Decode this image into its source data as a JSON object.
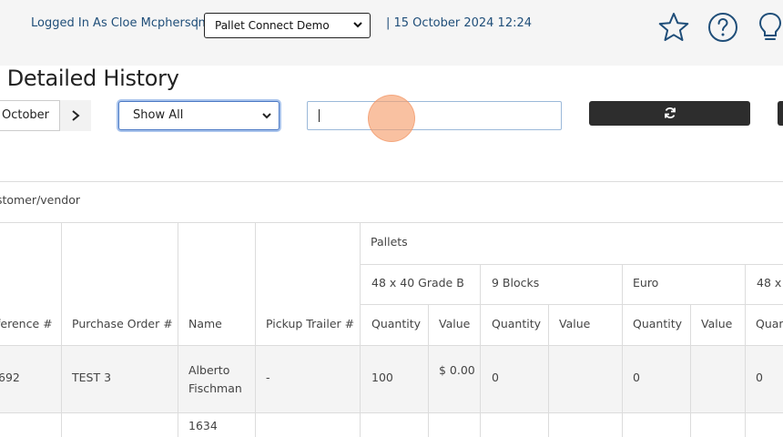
{
  "header": {
    "user_text": "Logged In As Cloe Mcpherson",
    "separator": "|",
    "company_selected": "Pallet Connect Demo",
    "datetime_text": "| 15 October 2024 12:24",
    "icons": [
      "star-icon",
      "help-circle-icon",
      "lightbulb-icon"
    ]
  },
  "page": {
    "title": "l Detailed History"
  },
  "filters": {
    "month": "October",
    "show_filter": "Show All",
    "search_value": ""
  },
  "table": {
    "customer_vendor_label": "stomer/vendor",
    "columns": {
      "reference": "ference #",
      "purchase_order": "Purchase Order #",
      "name": "Name",
      "pickup_trailer": "Pickup Trailer #",
      "pallets": "Pallets"
    },
    "pallet_types": [
      "48 x 40 Grade B",
      "9 Blocks",
      "Euro",
      "48 x"
    ],
    "sub_columns": {
      "quantity": "Quantity",
      "value": "Value",
      "quantity_truncated": "Quan"
    },
    "rows": [
      {
        "reference": "692",
        "purchase_order": "TEST 3",
        "name": "Alberto Fischman",
        "pickup_trailer": "-",
        "grade_b_qty": "100",
        "grade_b_value": "$ 0.00",
        "blocks_qty": "0",
        "blocks_value": "",
        "euro_qty": "0",
        "euro_value": "",
        "extra_qty": "0"
      },
      {
        "name": "1634"
      }
    ]
  },
  "colors": {
    "link_blue": "#1f4e79",
    "dark_button": "#2d2d2d",
    "topbar": "#f5f5f5",
    "click_marker": "#f6a06e"
  }
}
